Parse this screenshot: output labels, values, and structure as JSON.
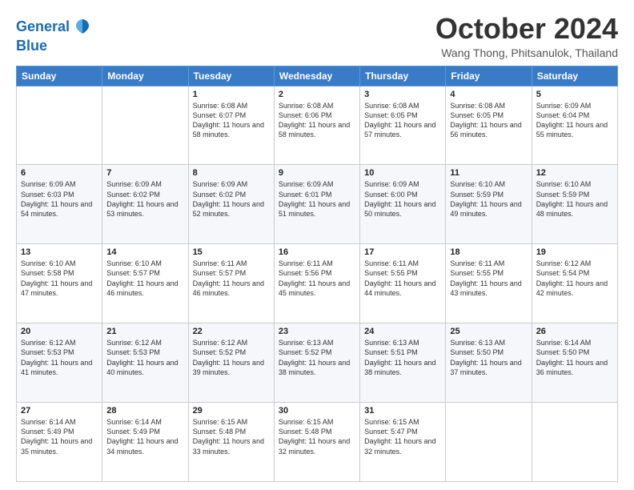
{
  "header": {
    "logo_line1": "General",
    "logo_line2": "Blue",
    "month_title": "October 2024",
    "location": "Wang Thong, Phitsanulok, Thailand"
  },
  "weekdays": [
    "Sunday",
    "Monday",
    "Tuesday",
    "Wednesday",
    "Thursday",
    "Friday",
    "Saturday"
  ],
  "weeks": [
    [
      {
        "day": "",
        "sunrise": "",
        "sunset": "",
        "daylight": ""
      },
      {
        "day": "",
        "sunrise": "",
        "sunset": "",
        "daylight": ""
      },
      {
        "day": "1",
        "sunrise": "Sunrise: 6:08 AM",
        "sunset": "Sunset: 6:07 PM",
        "daylight": "Daylight: 11 hours and 58 minutes."
      },
      {
        "day": "2",
        "sunrise": "Sunrise: 6:08 AM",
        "sunset": "Sunset: 6:06 PM",
        "daylight": "Daylight: 11 hours and 58 minutes."
      },
      {
        "day": "3",
        "sunrise": "Sunrise: 6:08 AM",
        "sunset": "Sunset: 6:05 PM",
        "daylight": "Daylight: 11 hours and 57 minutes."
      },
      {
        "day": "4",
        "sunrise": "Sunrise: 6:08 AM",
        "sunset": "Sunset: 6:05 PM",
        "daylight": "Daylight: 11 hours and 56 minutes."
      },
      {
        "day": "5",
        "sunrise": "Sunrise: 6:09 AM",
        "sunset": "Sunset: 6:04 PM",
        "daylight": "Daylight: 11 hours and 55 minutes."
      }
    ],
    [
      {
        "day": "6",
        "sunrise": "Sunrise: 6:09 AM",
        "sunset": "Sunset: 6:03 PM",
        "daylight": "Daylight: 11 hours and 54 minutes."
      },
      {
        "day": "7",
        "sunrise": "Sunrise: 6:09 AM",
        "sunset": "Sunset: 6:02 PM",
        "daylight": "Daylight: 11 hours and 53 minutes."
      },
      {
        "day": "8",
        "sunrise": "Sunrise: 6:09 AM",
        "sunset": "Sunset: 6:02 PM",
        "daylight": "Daylight: 11 hours and 52 minutes."
      },
      {
        "day": "9",
        "sunrise": "Sunrise: 6:09 AM",
        "sunset": "Sunset: 6:01 PM",
        "daylight": "Daylight: 11 hours and 51 minutes."
      },
      {
        "day": "10",
        "sunrise": "Sunrise: 6:09 AM",
        "sunset": "Sunset: 6:00 PM",
        "daylight": "Daylight: 11 hours and 50 minutes."
      },
      {
        "day": "11",
        "sunrise": "Sunrise: 6:10 AM",
        "sunset": "Sunset: 5:59 PM",
        "daylight": "Daylight: 11 hours and 49 minutes."
      },
      {
        "day": "12",
        "sunrise": "Sunrise: 6:10 AM",
        "sunset": "Sunset: 5:59 PM",
        "daylight": "Daylight: 11 hours and 48 minutes."
      }
    ],
    [
      {
        "day": "13",
        "sunrise": "Sunrise: 6:10 AM",
        "sunset": "Sunset: 5:58 PM",
        "daylight": "Daylight: 11 hours and 47 minutes."
      },
      {
        "day": "14",
        "sunrise": "Sunrise: 6:10 AM",
        "sunset": "Sunset: 5:57 PM",
        "daylight": "Daylight: 11 hours and 46 minutes."
      },
      {
        "day": "15",
        "sunrise": "Sunrise: 6:11 AM",
        "sunset": "Sunset: 5:57 PM",
        "daylight": "Daylight: 11 hours and 46 minutes."
      },
      {
        "day": "16",
        "sunrise": "Sunrise: 6:11 AM",
        "sunset": "Sunset: 5:56 PM",
        "daylight": "Daylight: 11 hours and 45 minutes."
      },
      {
        "day": "17",
        "sunrise": "Sunrise: 6:11 AM",
        "sunset": "Sunset: 5:55 PM",
        "daylight": "Daylight: 11 hours and 44 minutes."
      },
      {
        "day": "18",
        "sunrise": "Sunrise: 6:11 AM",
        "sunset": "Sunset: 5:55 PM",
        "daylight": "Daylight: 11 hours and 43 minutes."
      },
      {
        "day": "19",
        "sunrise": "Sunrise: 6:12 AM",
        "sunset": "Sunset: 5:54 PM",
        "daylight": "Daylight: 11 hours and 42 minutes."
      }
    ],
    [
      {
        "day": "20",
        "sunrise": "Sunrise: 6:12 AM",
        "sunset": "Sunset: 5:53 PM",
        "daylight": "Daylight: 11 hours and 41 minutes."
      },
      {
        "day": "21",
        "sunrise": "Sunrise: 6:12 AM",
        "sunset": "Sunset: 5:53 PM",
        "daylight": "Daylight: 11 hours and 40 minutes."
      },
      {
        "day": "22",
        "sunrise": "Sunrise: 6:12 AM",
        "sunset": "Sunset: 5:52 PM",
        "daylight": "Daylight: 11 hours and 39 minutes."
      },
      {
        "day": "23",
        "sunrise": "Sunrise: 6:13 AM",
        "sunset": "Sunset: 5:52 PM",
        "daylight": "Daylight: 11 hours and 38 minutes."
      },
      {
        "day": "24",
        "sunrise": "Sunrise: 6:13 AM",
        "sunset": "Sunset: 5:51 PM",
        "daylight": "Daylight: 11 hours and 38 minutes."
      },
      {
        "day": "25",
        "sunrise": "Sunrise: 6:13 AM",
        "sunset": "Sunset: 5:50 PM",
        "daylight": "Daylight: 11 hours and 37 minutes."
      },
      {
        "day": "26",
        "sunrise": "Sunrise: 6:14 AM",
        "sunset": "Sunset: 5:50 PM",
        "daylight": "Daylight: 11 hours and 36 minutes."
      }
    ],
    [
      {
        "day": "27",
        "sunrise": "Sunrise: 6:14 AM",
        "sunset": "Sunset: 5:49 PM",
        "daylight": "Daylight: 11 hours and 35 minutes."
      },
      {
        "day": "28",
        "sunrise": "Sunrise: 6:14 AM",
        "sunset": "Sunset: 5:49 PM",
        "daylight": "Daylight: 11 hours and 34 minutes."
      },
      {
        "day": "29",
        "sunrise": "Sunrise: 6:15 AM",
        "sunset": "Sunset: 5:48 PM",
        "daylight": "Daylight: 11 hours and 33 minutes."
      },
      {
        "day": "30",
        "sunrise": "Sunrise: 6:15 AM",
        "sunset": "Sunset: 5:48 PM",
        "daylight": "Daylight: 11 hours and 32 minutes."
      },
      {
        "day": "31",
        "sunrise": "Sunrise: 6:15 AM",
        "sunset": "Sunset: 5:47 PM",
        "daylight": "Daylight: 11 hours and 32 minutes."
      },
      {
        "day": "",
        "sunrise": "",
        "sunset": "",
        "daylight": ""
      },
      {
        "day": "",
        "sunrise": "",
        "sunset": "",
        "daylight": ""
      }
    ]
  ]
}
